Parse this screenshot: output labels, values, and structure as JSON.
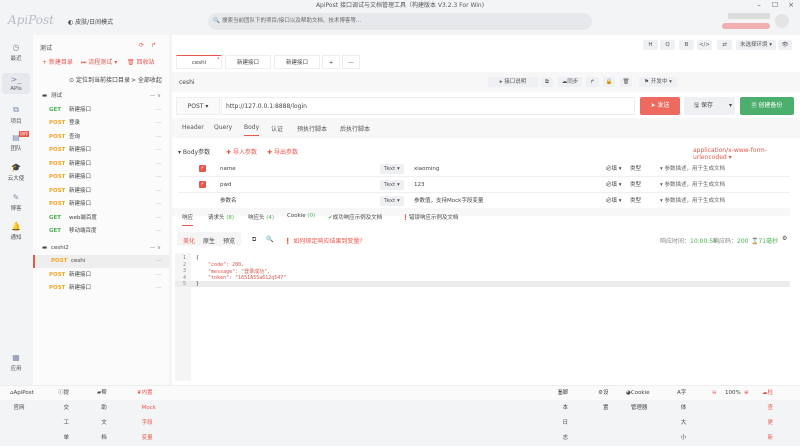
{
  "window": {
    "title": "ApiPost 接口调试与文档管理工具（构建版本 V3.2.3 For Win)",
    "min": "–",
    "max": "☐",
    "close": "×"
  },
  "header": {
    "logo": "ApiPost",
    "mode": "皮肤/日间模式",
    "search_placeholder": "搜索当前团队下的项目/接口以及帮助文档、技术博客等..."
  },
  "rail": [
    {
      "icon": "clock-icon",
      "label": "最近"
    },
    {
      "icon": "terminal-icon",
      "label": "APIs"
    },
    {
      "icon": "project-icon",
      "label": "项目"
    },
    {
      "icon": "team-icon",
      "label": "团队",
      "badge": "协作"
    },
    {
      "icon": "graduation-icon",
      "label": "云大使"
    },
    {
      "icon": "edit-icon",
      "label": "博客"
    },
    {
      "icon": "bell-icon",
      "label": "通知"
    },
    {
      "icon": "apps-icon",
      "label": "应用"
    }
  ],
  "sidebar": {
    "project": "测试",
    "new_dir": "+ 新建目录",
    "flow_test": "⏭ 流程测试 ▾",
    "recycle": "🗑 回收站",
    "locate": "定位到当前接口目录",
    "collapse": "> 全部收起",
    "folders": [
      {
        "name": "测试",
        "items": [
          [
            "GET",
            "新建接口"
          ],
          [
            "POST",
            "登录"
          ],
          [
            "POST",
            "查询"
          ],
          [
            "POST",
            "新建接口"
          ],
          [
            "POST",
            "新建接口"
          ],
          [
            "POST",
            "新建接口"
          ],
          [
            "POST",
            "新建接口"
          ],
          [
            "POST",
            "新建接口"
          ],
          [
            "GET",
            "web端百度"
          ],
          [
            "GET",
            "移动端百度"
          ]
        ]
      },
      {
        "name": "ceshi2",
        "items": [
          [
            "POST",
            "ceshi"
          ],
          [
            "POST",
            "新建接口"
          ],
          [
            "POST",
            "新建接口"
          ]
        ]
      }
    ]
  },
  "toolbar": {
    "h": "H",
    "q": "Q",
    "b": "B",
    "code": "</>",
    "fmt": "⇄",
    "env": "未选择环境 ▾",
    "eye": "👁"
  },
  "tabs": [
    {
      "label": "ceshi"
    },
    {
      "label": "新建接口"
    },
    {
      "label": "新建接口"
    }
  ],
  "add_tab": "+",
  "more_tabs": "—",
  "api": {
    "name": "ceshi",
    "doc": "▸ 接口说明",
    "sync": "同步",
    "status": "开发中 ▾",
    "method": "POST ▾",
    "url": "http://127.0.0.1:8888/login",
    "send": "发送",
    "save": "保存",
    "backup": "创建备份"
  },
  "req_tabs": [
    "Header",
    "Query",
    "Body",
    "认证",
    "预执行脚本",
    "后执行脚本"
  ],
  "body": {
    "title": "▾ Body参数",
    "import": "导入参数",
    "export": "导出参数",
    "content_type": "application/x-www-form-urlencoded ▾",
    "params": [
      {
        "checked": true,
        "key": "name",
        "type": "Text ▾",
        "value": "xiaoming"
      },
      {
        "checked": true,
        "key": "pwd",
        "type": "Text ▾",
        "value": "123"
      },
      {
        "checked": false,
        "key": "参数名",
        "type": "Text ▾",
        "value": "参数值，支持Mock字段变量"
      }
    ],
    "required": "必填",
    "dtype": "类型",
    "desc": "参数描述，用于生成文档"
  },
  "resp_tabs": [
    {
      "label": "响应"
    },
    {
      "label": "请求头",
      "count": "(8)"
    },
    {
      "label": "响应头",
      "count": "(4)"
    },
    {
      "label": "Cookie",
      "count": "(0)"
    },
    {
      "label": "成功响应示例及文档"
    },
    {
      "label": "错误响应示例及文档"
    }
  ],
  "resp": {
    "views": [
      "美化",
      "原生",
      "预览"
    ],
    "bind_tip": "如何绑定响应结果到变量?",
    "time_label": "响应时间：",
    "time": "10:00:58",
    "code_label": "响应码：",
    "code": "200",
    "dur": "71毫秒",
    "lines": [
      "{",
      "    \"code\": 200,",
      "    \"message\": \"登录成功\",",
      "    \"token\": \"1651A55a612q547\"",
      "}"
    ]
  },
  "footer": {
    "site": "ApiPost官网",
    "ticket": "提交工单",
    "help": "帮助文档",
    "mock": "内置Mock字段变量",
    "log": "脚本日志",
    "settings": "设置",
    "cookie": "Cookie管理器",
    "font": "字体大小",
    "zoom": "100%",
    "update": "检查更新"
  },
  "colors": {
    "accent": "#e8574d",
    "get": "#4caf50",
    "post": "#f5a623",
    "backup": "#4caf50"
  }
}
